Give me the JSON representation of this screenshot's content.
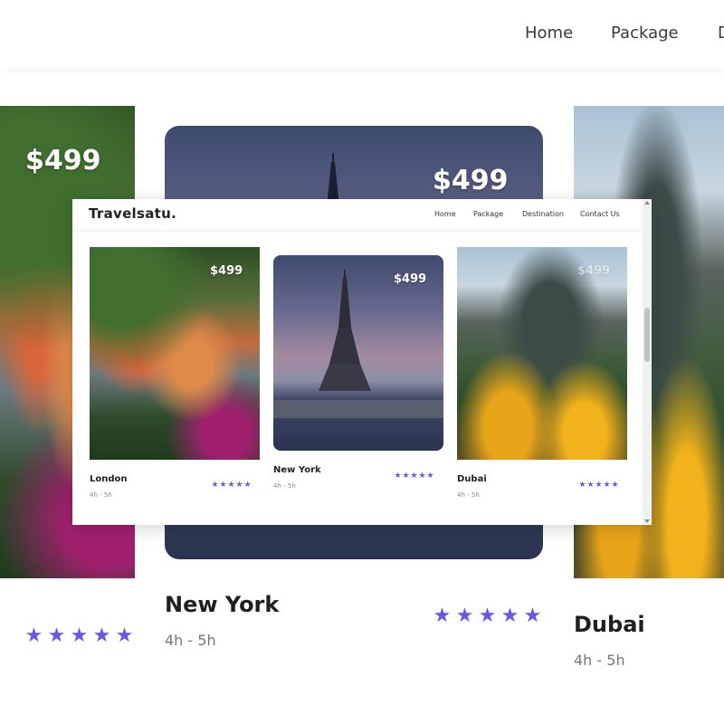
{
  "brand": "Travelsatu.",
  "nav": [
    "Home",
    "Package",
    "Destination",
    "Contact Us"
  ],
  "background_nav_visible": [
    "Home",
    "Package",
    "D"
  ],
  "accent_color": "#6c55e6",
  "cards": [
    {
      "city": "London",
      "price": "$499",
      "duration": "4h - 5h",
      "rating": 5
    },
    {
      "city": "New York",
      "price": "$499",
      "duration": "4h - 5h",
      "rating": 5
    },
    {
      "city": "Dubai",
      "price": "$499",
      "duration": "4h - 5h",
      "rating": 5
    }
  ],
  "star_glyph": "★"
}
